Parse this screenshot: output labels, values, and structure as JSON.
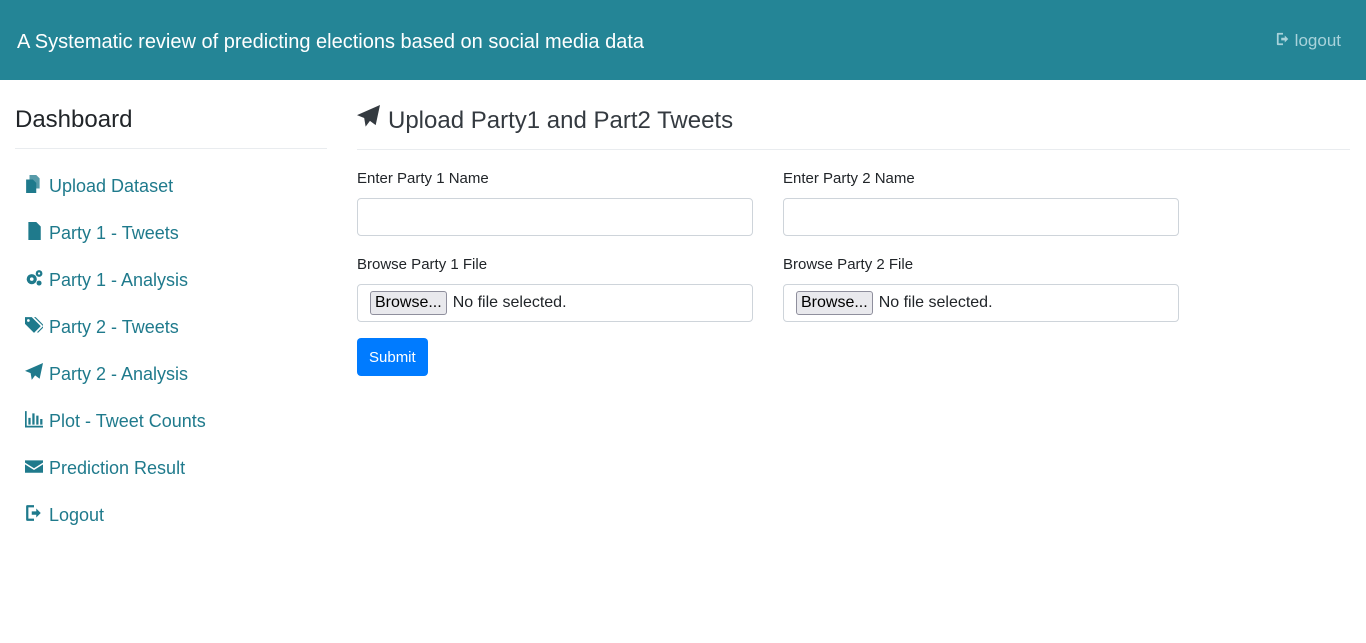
{
  "header": {
    "title": "A Systematic review of predicting elections based on social media data",
    "logout_label": "logout",
    "logout_icon": "sign-out-icon",
    "background_color": "#248596"
  },
  "sidebar": {
    "heading": "Dashboard",
    "items": [
      {
        "label": "Upload Dataset",
        "icon": "files-icon"
      },
      {
        "label": "Party 1 - Tweets",
        "icon": "file-icon"
      },
      {
        "label": "Party 1 - Analysis",
        "icon": "cogs-icon"
      },
      {
        "label": "Party 2 - Tweets",
        "icon": "tags-icon"
      },
      {
        "label": "Party 2 - Analysis",
        "icon": "paper-plane-icon"
      },
      {
        "label": "Plot - Tweet Counts",
        "icon": "bar-chart-icon"
      },
      {
        "label": "Prediction Result",
        "icon": "envelope-icon"
      },
      {
        "label": "Logout",
        "icon": "sign-out-icon"
      }
    ],
    "link_color": "#1f7a8c"
  },
  "main": {
    "title": "Upload Party1 and Part2 Tweets",
    "title_icon": "paper-plane-icon",
    "party1_name_label": "Enter Party 1 Name",
    "party1_name_value": "",
    "party2_name_label": "Enter Party 2 Name",
    "party2_name_value": "",
    "party1_file_label": "Browse Party 1 File",
    "party2_file_label": "Browse Party 2 File",
    "browse_label": "Browse...",
    "no_file_text": "No file selected.",
    "submit_label": "Submit",
    "submit_color": "#007bff"
  }
}
